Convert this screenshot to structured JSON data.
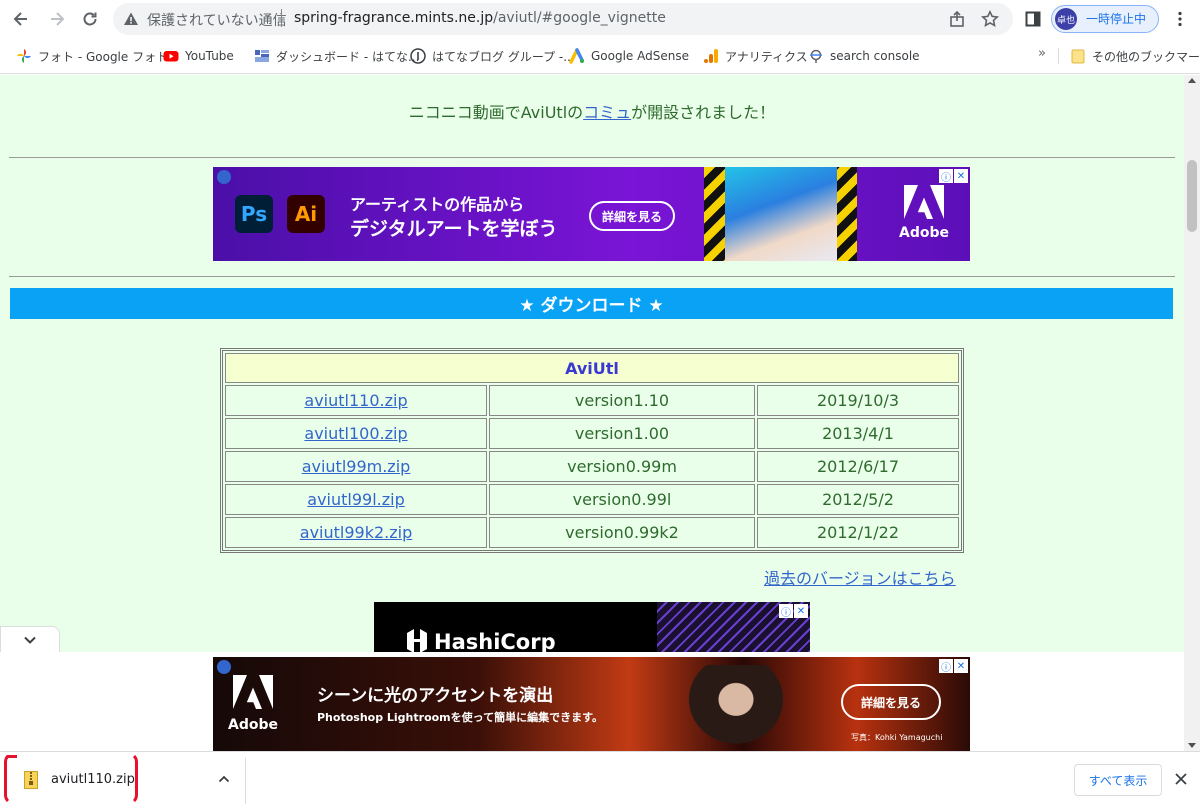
{
  "toolbar": {
    "security_text": "保護されていない通信",
    "url_host": "spring-fragrance.mints.ne.jp",
    "url_path": "/aviutl/#google_vignette",
    "profile_avatar": "卓也",
    "profile_label": "一時停止中"
  },
  "bookmarks": [
    {
      "label": "フォト - Google フォト",
      "icon": "google-photos-icon"
    },
    {
      "label": "YouTube",
      "icon": "youtube-icon"
    },
    {
      "label": "ダッシュボード - はてな...",
      "icon": "dashboard-icon"
    },
    {
      "label": "はてなブログ グループ -...",
      "icon": "hatena-icon"
    },
    {
      "label": "Google AdSense",
      "icon": "adsense-icon"
    },
    {
      "label": "アナリティクス",
      "icon": "analytics-icon"
    },
    {
      "label": "search console",
      "icon": "search-console-icon"
    }
  ],
  "bookmarks_more": "»",
  "bookmarks_other": "その他のブックマーク",
  "page": {
    "notice_prefix": "ニコニコ動画でAviUtlの",
    "notice_link": "コミュ",
    "notice_suffix": "が開設されました！",
    "download_heading": "★ ダウンロード ★",
    "table_title": "AviUtl",
    "rows": [
      {
        "file": "aviutl110.zip",
        "version": "version1.10",
        "date": "2019/10/3"
      },
      {
        "file": "aviutl100.zip",
        "version": "version1.00",
        "date": "2013/4/1"
      },
      {
        "file": "aviutl99m.zip",
        "version": "version0.99m",
        "date": "2012/6/17"
      },
      {
        "file": "aviutl99l.zip",
        "version": "version0.99l",
        "date": "2012/5/2"
      },
      {
        "file": "aviutl99k2.zip",
        "version": "version0.99k2",
        "date": "2012/1/22"
      }
    ],
    "past_versions_link": "過去のバージョンはこちら"
  },
  "ads": {
    "ad1": {
      "line1": "アーティストの作品から",
      "line2": "デジタルアートを学ぼう",
      "button": "詳細を見る",
      "brand": "Adobe",
      "ps": "Ps",
      "ai": "Ai"
    },
    "ad2": {
      "brand": "HashiCorp"
    },
    "ad3": {
      "brand": "Adobe",
      "line1": "シーンに光のアクセントを演出",
      "line2": "Photoshop Lightroomを使って簡単に編集できます。",
      "button": "詳細を見る",
      "credit": "写真：Kohki Yamaguchi"
    }
  },
  "download_shelf": {
    "file_name": "aviutl110.zip",
    "show_all": "すべて表示"
  },
  "colors": {
    "page_bg": "#eaffea",
    "heading_bar": "#0aa2f5",
    "link": "#3366cc",
    "annotation": "#e8112d"
  }
}
